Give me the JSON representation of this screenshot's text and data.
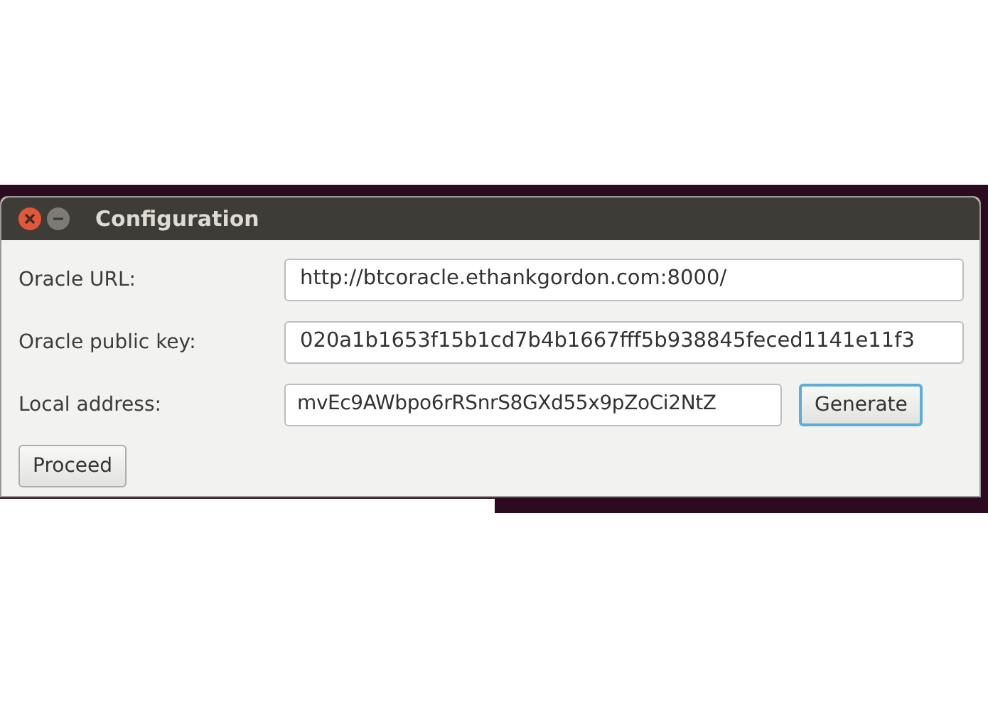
{
  "window": {
    "title": "Configuration"
  },
  "fields": [
    {
      "label": "Oracle URL:",
      "value": "http://btcoracle.ethankgordon.com:8000/"
    },
    {
      "label": "Oracle public key:",
      "value": "020a1b1653f15b1cd7b4b1667fff5b938845feced1141e11f3"
    },
    {
      "label": "Local address:",
      "value": "mvEc9AWbpo6rRSnrS8GXd55x9pZoCi2NtZ",
      "button": {
        "label": "Generate",
        "focused": true
      }
    }
  ],
  "buttons": [
    {
      "label": "Proceed",
      "focused": false
    }
  ]
}
